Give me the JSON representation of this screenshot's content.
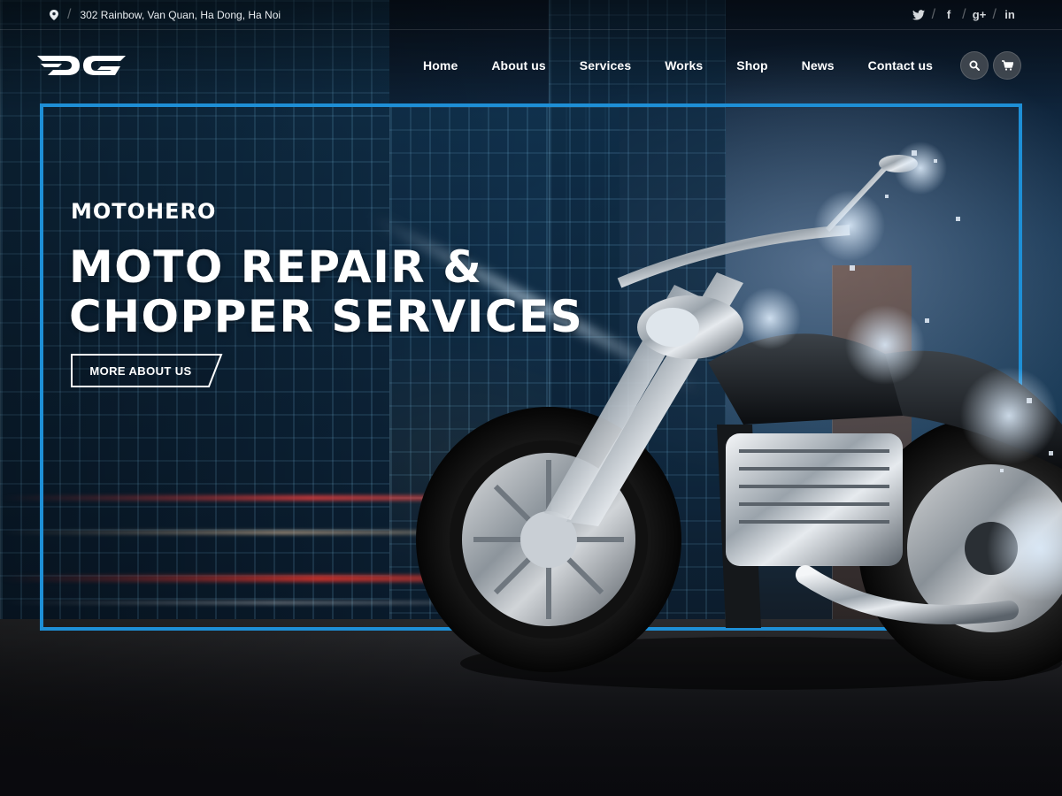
{
  "topbar": {
    "address": "302 Rainbow, Van Quan, Ha Dong, Ha Noi",
    "address_icon": "map-pin-icon",
    "social": [
      {
        "icon": "twitter-icon",
        "glyph": "🐦"
      },
      {
        "icon": "facebook-icon",
        "glyph": "f"
      },
      {
        "icon": "google-plus-icon",
        "glyph": "g+"
      },
      {
        "icon": "linkedin-icon",
        "glyph": "in"
      }
    ]
  },
  "nav": {
    "logo_icon": "brand-logo-icon",
    "links": [
      "Home",
      "About us",
      "Services",
      "Works",
      "Shop",
      "News",
      "Contact us"
    ],
    "search_icon": "search-icon",
    "cart_icon": "cart-icon"
  },
  "hero": {
    "eyebrow": "MOTOHERO",
    "headline_line1": "MOTO REPAIR &",
    "headline_line2": "CHOPPER SERVICES",
    "cta_label": "MORE ABOUT US",
    "image_icon": "motorcycle-image"
  },
  "colors": {
    "accent": "#1e8fd6",
    "text": "#ffffff",
    "background": "#0d0f14"
  }
}
